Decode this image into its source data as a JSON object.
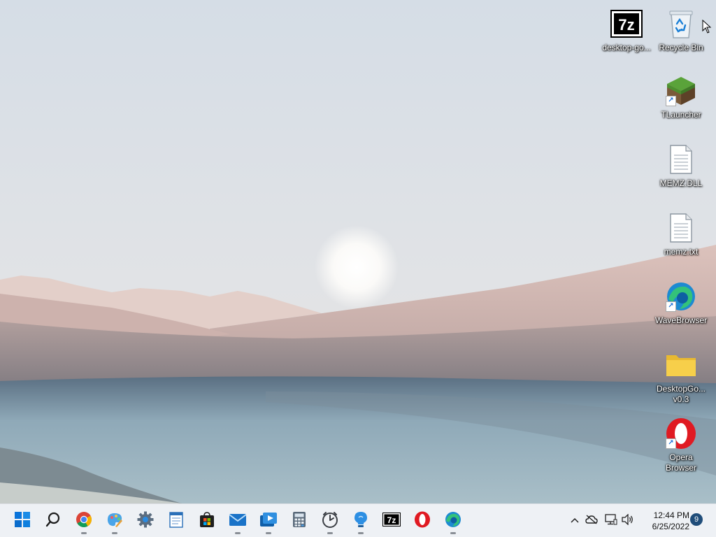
{
  "desktop": {
    "icons": [
      {
        "label": "desktop-go...",
        "icon": "7zip-archive-icon"
      },
      {
        "label": "Recycle Bin",
        "icon": "recycle-bin-icon"
      },
      {
        "label": "TLauncher",
        "icon": "grass-block-icon"
      },
      {
        "label": "MEMZ.DLL",
        "icon": "document-icon"
      },
      {
        "label": "memz.txt",
        "icon": "text-file-icon"
      },
      {
        "label": "WaveBrowser",
        "icon": "wavebrowser-icon"
      },
      {
        "label": "DesktopGo... v0.3",
        "icon": "folder-icon"
      },
      {
        "label": "Opera Browser",
        "icon": "opera-icon"
      }
    ]
  },
  "taskbar": {
    "apps": [
      {
        "name": "Start",
        "icon": "windows-start-icon"
      },
      {
        "name": "Search",
        "icon": "search-icon"
      },
      {
        "name": "Google Chrome",
        "icon": "chrome-icon"
      },
      {
        "name": "Paint",
        "icon": "paint-icon"
      },
      {
        "name": "Settings",
        "icon": "gear-icon"
      },
      {
        "name": "Notepad",
        "icon": "notepad-icon"
      },
      {
        "name": "Microsoft Store",
        "icon": "store-icon"
      },
      {
        "name": "Mail",
        "icon": "mail-icon"
      },
      {
        "name": "Media Player",
        "icon": "media-player-icon"
      },
      {
        "name": "Calculator",
        "icon": "calculator-icon"
      },
      {
        "name": "Clock",
        "icon": "clock-icon"
      },
      {
        "name": "Tips",
        "icon": "lightbulb-icon"
      },
      {
        "name": "7-Zip",
        "icon": "7zip-icon"
      },
      {
        "name": "Opera",
        "icon": "opera-icon"
      },
      {
        "name": "WaveBrowser",
        "icon": "wavebrowser-icon"
      }
    ],
    "tray": {
      "time": "12:44 PM",
      "date": "6/25/2022",
      "notification_count": "9"
    }
  },
  "colors": {
    "taskbar_bg": "#eef1f5",
    "accent_blue": "#0078d4",
    "opera_red": "#e01a22",
    "folder_yellow": "#f7cf4a"
  }
}
